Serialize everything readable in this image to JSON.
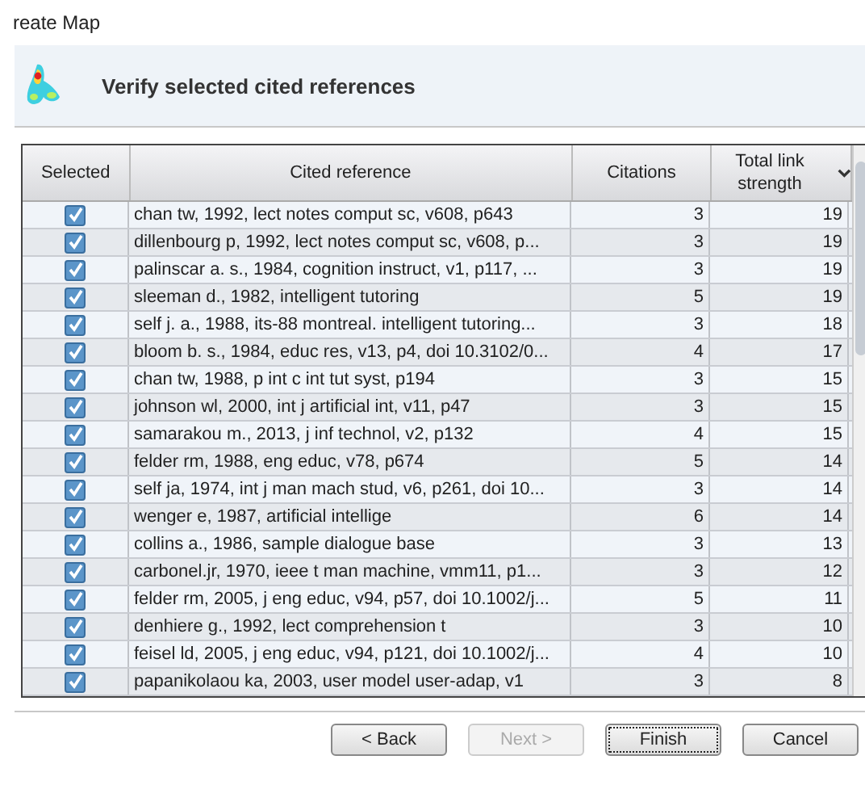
{
  "window": {
    "title": "reate Map"
  },
  "header": {
    "title": "Verify selected cited references"
  },
  "table": {
    "columns": [
      "Selected",
      "Cited reference",
      "Citations",
      "Total link strength"
    ],
    "rows": [
      {
        "checked": true,
        "reference": "chan tw, 1992, lect notes comput sc, v608, p643",
        "citations": "3",
        "strength": "19"
      },
      {
        "checked": true,
        "reference": "dillenbourg p, 1992, lect notes comput sc, v608, p...",
        "citations": "3",
        "strength": "19"
      },
      {
        "checked": true,
        "reference": "palinscar a. s., 1984, cognition instruct, v1, p117, ...",
        "citations": "3",
        "strength": "19"
      },
      {
        "checked": true,
        "reference": "sleeman d., 1982, intelligent tutoring",
        "citations": "5",
        "strength": "19"
      },
      {
        "checked": true,
        "reference": "self j. a., 1988, its-88 montreal. intelligent tutoring...",
        "citations": "3",
        "strength": "18"
      },
      {
        "checked": true,
        "reference": "bloom b. s., 1984, educ res, v13, p4, doi 10.3102/0...",
        "citations": "4",
        "strength": "17"
      },
      {
        "checked": true,
        "reference": "chan tw, 1988, p int c int tut syst, p194",
        "citations": "3",
        "strength": "15"
      },
      {
        "checked": true,
        "reference": "johnson wl, 2000, int j artificial int, v11, p47",
        "citations": "3",
        "strength": "15"
      },
      {
        "checked": true,
        "reference": "samarakou m., 2013, j inf technol, v2, p132",
        "citations": "4",
        "strength": "15"
      },
      {
        "checked": true,
        "reference": "felder rm, 1988, eng educ, v78, p674",
        "citations": "5",
        "strength": "14"
      },
      {
        "checked": true,
        "reference": "self ja, 1974, int j man mach stud, v6, p261, doi 10...",
        "citations": "3",
        "strength": "14"
      },
      {
        "checked": true,
        "reference": "wenger e, 1987, artificial intellige",
        "citations": "6",
        "strength": "14"
      },
      {
        "checked": true,
        "reference": "collins a., 1986, sample dialogue base",
        "citations": "3",
        "strength": "13"
      },
      {
        "checked": true,
        "reference": "carbonel.jr, 1970, ieee t man machine, vmm11, p1...",
        "citations": "3",
        "strength": "12"
      },
      {
        "checked": true,
        "reference": "felder rm, 2005, j eng educ, v94, p57, doi 10.1002/j...",
        "citations": "5",
        "strength": "11"
      },
      {
        "checked": true,
        "reference": "denhiere g., 1992, lect comprehension t",
        "citations": "3",
        "strength": "10"
      },
      {
        "checked": true,
        "reference": "feisel ld, 2005, j eng educ, v94, p121, doi 10.1002/j...",
        "citations": "4",
        "strength": "10"
      },
      {
        "checked": true,
        "reference": "papanikolaou ka, 2003, user model user-adap, v1",
        "citations": "3",
        "strength": "8"
      }
    ]
  },
  "buttons": [
    {
      "label": "< Back",
      "disabled": false,
      "focused": false
    },
    {
      "label": "Next >",
      "disabled": true,
      "focused": false
    },
    {
      "label": "Finish",
      "disabled": false,
      "focused": true
    },
    {
      "label": "Cancel",
      "disabled": false,
      "focused": false
    }
  ]
}
